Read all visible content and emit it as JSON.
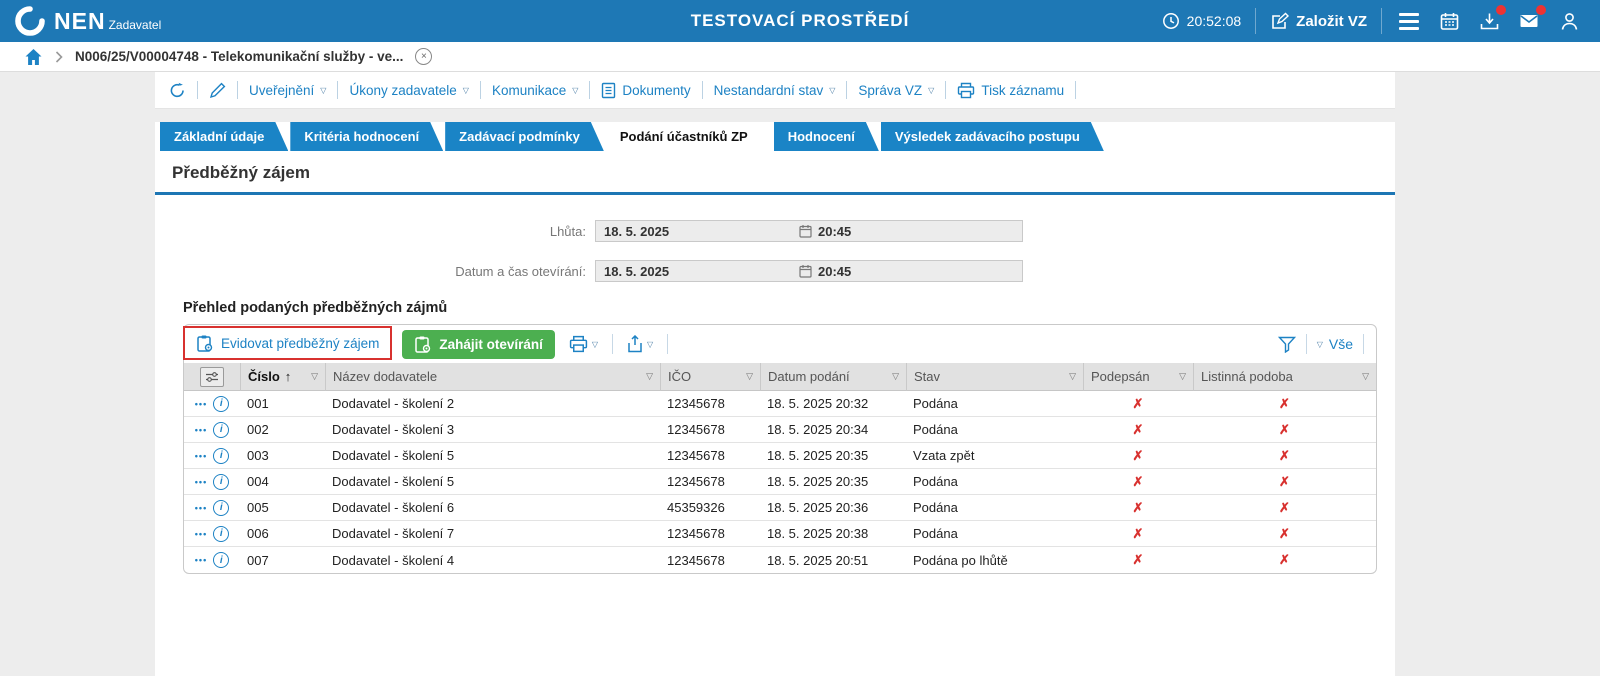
{
  "colors": {
    "topbar_blue": "#1e78b5",
    "tab_blue": "#1a84c6",
    "link_blue": "#1d82c4",
    "accent_underline": "#1d76b4",
    "green_button": "#4caf50",
    "alert_red": "#d8312f",
    "badge_red": "#ee3333"
  },
  "icons": {
    "dropdown_glyph": "▽",
    "sort_asc_glyph": "↑",
    "row_menu_glyph": "•••",
    "info_glyph": "i",
    "close_glyph": "×"
  },
  "topbar": {
    "logo_text": "NEN",
    "logo_subtitle": "Zadavatel",
    "environment_title": "TESTOVACÍ PROSTŘEDÍ",
    "clock_time": "20:52:08",
    "create_vz_label": "Založit VZ"
  },
  "breadcrumb": {
    "record_label": "N006/25/V00004748 - Telekomunikační služby - ve..."
  },
  "record_toolbar": {
    "publication": "Uveřejnění",
    "contracting_tasks": "Úkony zadavatele",
    "communication": "Komunikace",
    "documents": "Dokumenty",
    "nonstandard_state": "Nestandardní stav",
    "vz_admin": "Správa VZ",
    "print_record": "Tisk záznamu"
  },
  "tabs": [
    {
      "label": "Základní údaje",
      "active": false
    },
    {
      "label": "Kritéria hodnocení",
      "active": false
    },
    {
      "label": "Zadávací podmínky",
      "active": false
    },
    {
      "label": "Podání účastníků ZP",
      "active": true
    },
    {
      "label": "Hodnocení",
      "active": false
    },
    {
      "label": "Výsledek zadávacího postupu",
      "active": false
    }
  ],
  "section": {
    "title": "Předběžný zájem"
  },
  "form": {
    "deadline_label": "Lhůta:",
    "deadline_date": "18. 5. 2025",
    "deadline_time": "20:45",
    "opening_label": "Datum a čas otevírání:",
    "opening_date": "18. 5. 2025",
    "opening_time": "20:45"
  },
  "list": {
    "heading": "Přehled podaných předběžných zájmů",
    "register_button": "Evidovat předběžný zájem",
    "start_opening_button": "Zahájit otevírání",
    "filter_all_label": "Vše"
  },
  "table": {
    "columns": [
      "Číslo",
      "Název dodavatele",
      "IČO",
      "Datum podání",
      "Stav",
      "Podepsán",
      "Listinná podoba"
    ],
    "rows": [
      {
        "cislo": "001",
        "nazev": "Dodavatel - školení 2",
        "ico": "12345678",
        "datum": "18. 5. 2025 20:32",
        "stav": "Podána",
        "podepsan": "✗",
        "listinna": "✗"
      },
      {
        "cislo": "002",
        "nazev": "Dodavatel - školení 3",
        "ico": "12345678",
        "datum": "18. 5. 2025 20:34",
        "stav": "Podána",
        "podepsan": "✗",
        "listinna": "✗"
      },
      {
        "cislo": "003",
        "nazev": "Dodavatel - školení 5",
        "ico": "12345678",
        "datum": "18. 5. 2025 20:35",
        "stav": "Vzata zpět",
        "podepsan": "✗",
        "listinna": "✗"
      },
      {
        "cislo": "004",
        "nazev": "Dodavatel - školení 5",
        "ico": "12345678",
        "datum": "18. 5. 2025 20:35",
        "stav": "Podána",
        "podepsan": "✗",
        "listinna": "✗"
      },
      {
        "cislo": "005",
        "nazev": "Dodavatel - školení 6",
        "ico": "45359326",
        "datum": "18. 5. 2025 20:36",
        "stav": "Podána",
        "podepsan": "✗",
        "listinna": "✗"
      },
      {
        "cislo": "006",
        "nazev": "Dodavatel - školení 7",
        "ico": "12345678",
        "datum": "18. 5. 2025 20:38",
        "stav": "Podána",
        "podepsan": "✗",
        "listinna": "✗"
      },
      {
        "cislo": "007",
        "nazev": "Dodavatel - školení 4",
        "ico": "12345678",
        "datum": "18. 5. 2025 20:51",
        "stav": "Podána po lhůtě",
        "podepsan": "✗",
        "listinna": "✗"
      }
    ]
  }
}
